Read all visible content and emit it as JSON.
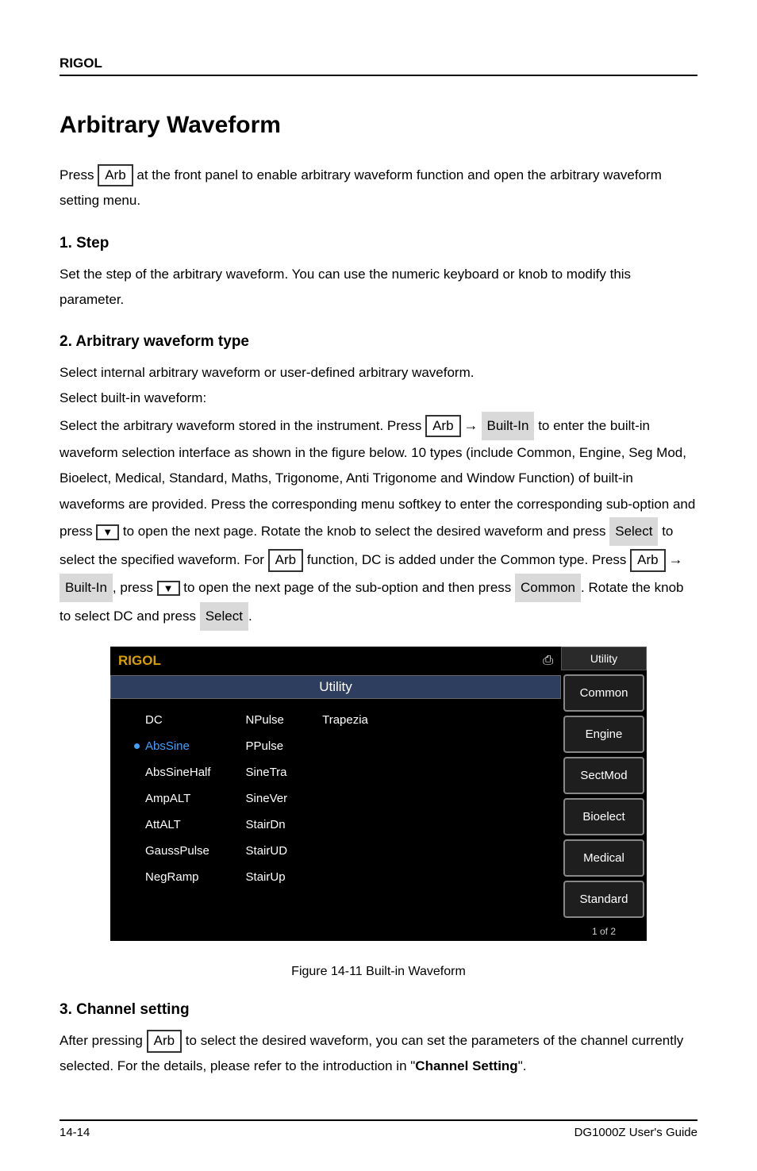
{
  "brand": "RIGOL",
  "heading": "Arbitrary Waveform",
  "para1_a": "Press ",
  "para1_key": "Arb",
  "para1_b": " at the front panel to enable arbitrary waveform function and open the arbitrary waveform setting menu.",
  "sub1": "1.  Step",
  "sub1_body": "Set the step of the arbitrary waveform. You can use the numeric keyboard or knob to modify this parameter.",
  "sub2": "2.  Arbitrary waveform type",
  "sub2_body_a": "Select internal arbitrary waveform or user-defined arbitrary waveform.",
  "sub2_body_b": "Select built-in waveform:",
  "sub2_body_c": "Select the arbitrary waveform stored in the instrument. Press ",
  "sub2_key1": "Arb",
  "sub2_arrow": "→",
  "sub2_soft1": "Built-In",
  "sub2_body_d": " to enter the built-in waveform selection interface as shown in the figure below. 10 types (include Common, Engine, Seg Mod, Bioelect, Medical, Standard, Maths, Trigonome, Anti Trigonome and Window Function) of built-in waveforms are provided. Press the corresponding menu softkey to enter the corresponding sub-option and press ",
  "sub2_menuarrow": "▼",
  "sub2_body_e": " to open the next page. Rotate the knob to select the desired waveform and press ",
  "sub2_soft2": "Select",
  "sub2_body_f": " to select the specified waveform.\n\nFor ",
  "sub2_key2": "Arb",
  "sub2_body_g": " function, DC is added under the Common type. Press ",
  "sub2_key3": "Arb",
  "sub2_arrow2": "→",
  "sub2_soft3": "Built-In",
  "sub2_body_h": ", press ",
  "sub2_menuarrow2": "▼",
  "sub2_body_i": " to open the next page of the sub-option and then press ",
  "sub2_soft4": "Common",
  "sub2_body_j": ". Rotate the knob to select DC and press ",
  "sub2_soft5": "Select",
  "sub2_body_k": ".",
  "screenshot": {
    "logo": "RIGOL",
    "title": "Utility",
    "right_header": "Utility",
    "cols": [
      [
        "DC",
        "AbsSine",
        "AbsSineHalf",
        "AmpALT",
        "AttALT",
        "GaussPulse",
        "NegRamp"
      ],
      [
        "NPulse",
        "PPulse",
        "SineTra",
        "SineVer",
        "StairDn",
        "StairUD",
        "StairUp"
      ],
      [
        "Trapezia"
      ]
    ],
    "selected": "AbsSine",
    "right_buttons": [
      "Common",
      "Engine",
      "SectMod",
      "Bioelect",
      "Medical",
      "Standard"
    ],
    "right_footer": "1 of 2"
  },
  "fig_caption": "Figure 14-11 Built-in Waveform",
  "sub3": "3.  Channel setting",
  "sub3_body_a": "After pressing ",
  "sub3_key": "Arb",
  "sub3_body_b": " to select the desired waveform, you can set the parameters of the channel currently selected. For the details, please refer to the introduction in \"",
  "sub3_bold": "Channel Setting",
  "sub3_body_c": "\".",
  "footer_left": "14-14",
  "footer_right": "DG1000Z User's Guide"
}
